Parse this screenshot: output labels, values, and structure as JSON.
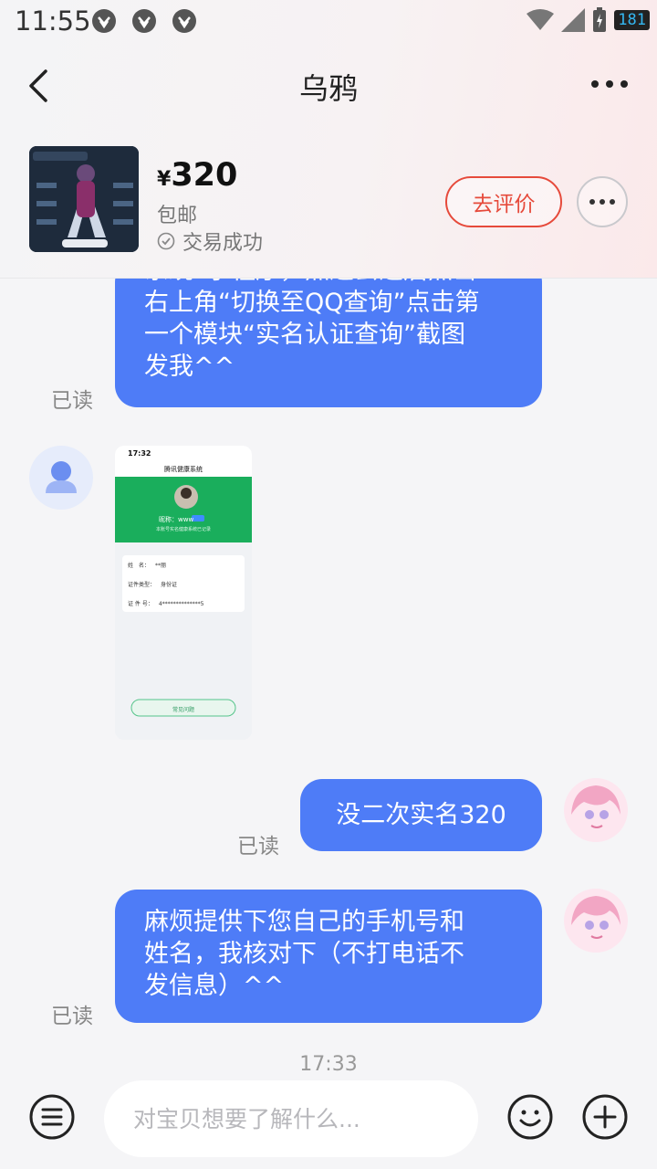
{
  "status_bar": {
    "time": "11:55",
    "battery": "181"
  },
  "header": {
    "title": "乌鸦"
  },
  "product": {
    "currency": "¥",
    "price": "320",
    "shipping": "包邮",
    "status": "交易成功",
    "review_button": "去评价"
  },
  "chat": {
    "msg1_partial_top": "系统”小程序，点进去之后点击",
    "msg1_lines": [
      "右上角“切换至QQ查询”点击第",
      "一个模块“实名认证查询”截图",
      "发我^^"
    ],
    "read_label": "已读",
    "screenshot": {
      "time": "17:32",
      "title": "腾讯健康系统",
      "nickname": "昵称：www",
      "desc": "本账号实名健康系统已记录",
      "name_label": "姓　名：",
      "name_value": "**丽",
      "id_type_label": "证件类型：",
      "id_type_value": "身份证",
      "id_no_label": "证 件 号：",
      "id_no_value": "4**************5",
      "faq_button": "常见问题"
    },
    "msg2": "没二次实名320",
    "msg3_lines": [
      "麻烦提供下您自己的手机号和",
      "姓名，我核对下（不打电话不",
      "发信息）^^"
    ],
    "time_sep": "17:33"
  },
  "input": {
    "placeholder": "对宝贝想要了解什么..."
  },
  "colors": {
    "bubble": "#4e7cf7",
    "accent_red": "#e64a3b",
    "green": "#1aae5c"
  }
}
